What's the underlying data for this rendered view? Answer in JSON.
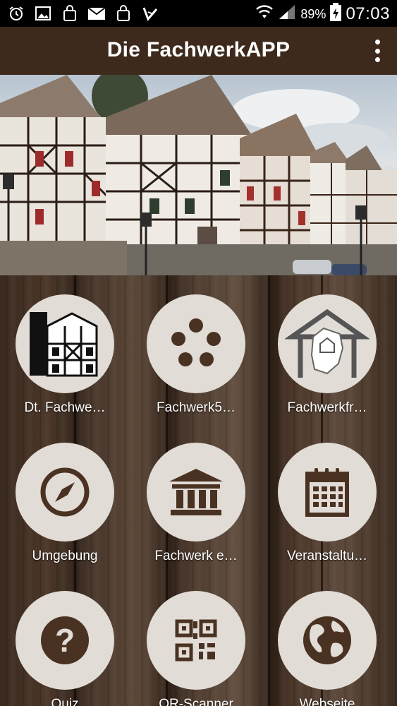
{
  "status_bar": {
    "time": "07:03",
    "battery_percent": "89%",
    "left_icons": [
      "alarm-icon",
      "image-icon",
      "shopping-bag-icon",
      "mail-icon",
      "shopping-bag-icon",
      "check-app-icon"
    ],
    "right_icons": [
      "wifi-icon",
      "signal-icon",
      "battery-charging-icon"
    ]
  },
  "app_bar": {
    "title": "Die FachwerkAPP",
    "menu_icon": "more-vert-icon"
  },
  "banner": {
    "slide_count": 2,
    "active_slide": 1
  },
  "tiles": [
    {
      "label": "Dt. Fachwe…",
      "icon": "half-timbered-house-drawing"
    },
    {
      "label": "Fachwerk5…",
      "icon": "five-dots-icon"
    },
    {
      "label": "Fachwerkfr…",
      "icon": "house-germany-map-logo"
    },
    {
      "label": "Umgebung",
      "icon": "compass-icon"
    },
    {
      "label": "Fachwerk e…",
      "icon": "museum-icon"
    },
    {
      "label": "Veranstaltu…",
      "icon": "calendar-icon"
    },
    {
      "label": "Quiz",
      "icon": "question-icon"
    },
    {
      "label": "QR-Scanner",
      "icon": "qr-code-icon"
    },
    {
      "label": "Webseite",
      "icon": "globe-icon"
    }
  ],
  "colors": {
    "app_bar": "#3d2a1c",
    "icon_brown": "#4a3222",
    "circle_bg": "#e2dcd7"
  }
}
